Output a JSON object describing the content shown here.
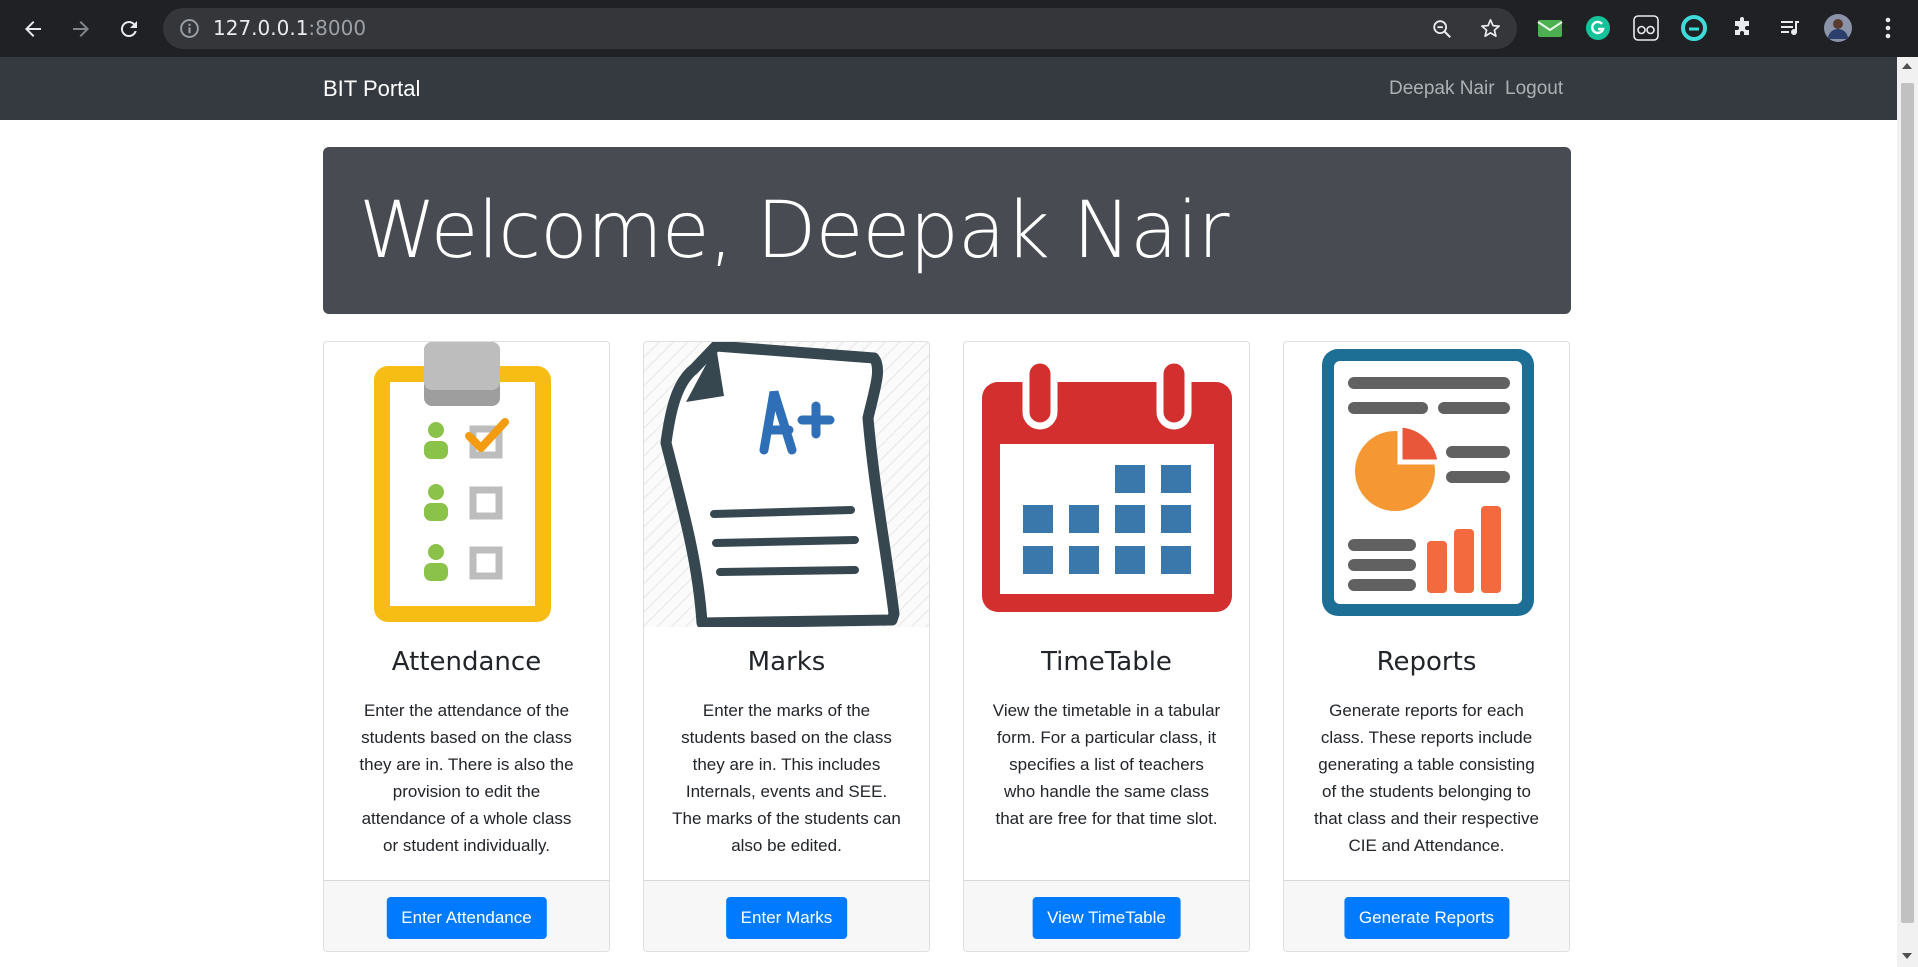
{
  "browser": {
    "url_host": "127.0.0.1",
    "url_port": ":8000"
  },
  "navbar": {
    "brand": "BIT Portal",
    "user_link": "Deepak Nair",
    "logout_link": "Logout"
  },
  "jumbotron": {
    "heading": "Welcome, Deepak Nair"
  },
  "cards": [
    {
      "title": "Attendance",
      "text": "Enter the attendance of the students based on the class they are in. There is also the provision to edit the attendance of a whole class or student individually.",
      "button": "Enter Attendance",
      "icon": "attendance-clipboard-icon"
    },
    {
      "title": "Marks",
      "text": "Enter the marks of the students based on the class they are in. This includes Internals, events and SEE. The marks of the students can also be edited.",
      "button": "Enter Marks",
      "icon": "marks-paper-icon"
    },
    {
      "title": "TimeTable",
      "text": "View the timetable in a tabular form. For a particular class, it specifies a list of teachers who handle the same class that are free for that time slot.",
      "button": "View TimeTable",
      "icon": "calendar-icon"
    },
    {
      "title": "Reports",
      "text": "Generate reports for each class. These reports include generating a table consisting of the students belonging to that class and their respective CIE and Attendance.",
      "button": "Generate Reports",
      "icon": "report-icon"
    }
  ],
  "colors": {
    "navbar": "#343a40",
    "jumbotron": "#484b52",
    "primary": "#007bff"
  }
}
